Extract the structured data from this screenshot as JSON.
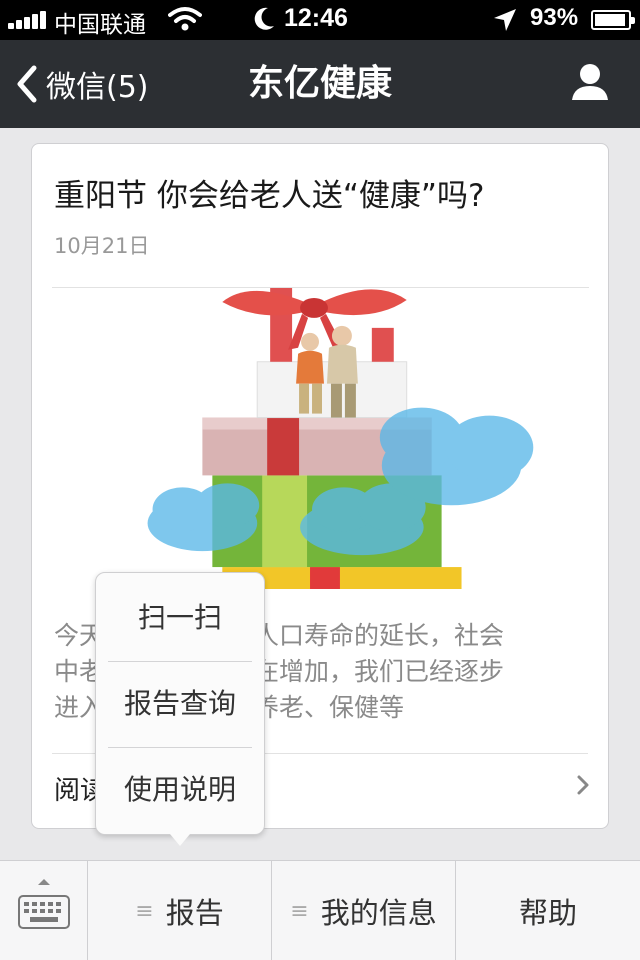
{
  "status_bar": {
    "carrier": "中国联通",
    "time": "12:46",
    "battery": "93%",
    "signal_bars": 5,
    "battery_level": 0.93
  },
  "nav": {
    "back_label": "微信(5)",
    "title": "东亿健康",
    "profile_icon": "person-icon"
  },
  "article": {
    "title": "重阳节 你会给老人送“健康”吗?",
    "date": "10月21日",
    "excerpt_lines": [
      "今天　　　　随着人口寿命的延长，社会",
      "中老　　　　重也在增加，我们已经逐步",
      "进入　　　　包括养老、保健等"
    ],
    "read_more": "阅读全文"
  },
  "popup_menu": {
    "items": [
      "扫一扫",
      "报告查询",
      "使用说明"
    ]
  },
  "bottom_menu": {
    "keyboard_icon": "keyboard-icon",
    "items": [
      "报告",
      "我的信息",
      "帮助"
    ]
  },
  "colors": {
    "nav_bg": "#2c2f33",
    "status_bg": "#000000",
    "page_bg": "#e8e8ea"
  }
}
